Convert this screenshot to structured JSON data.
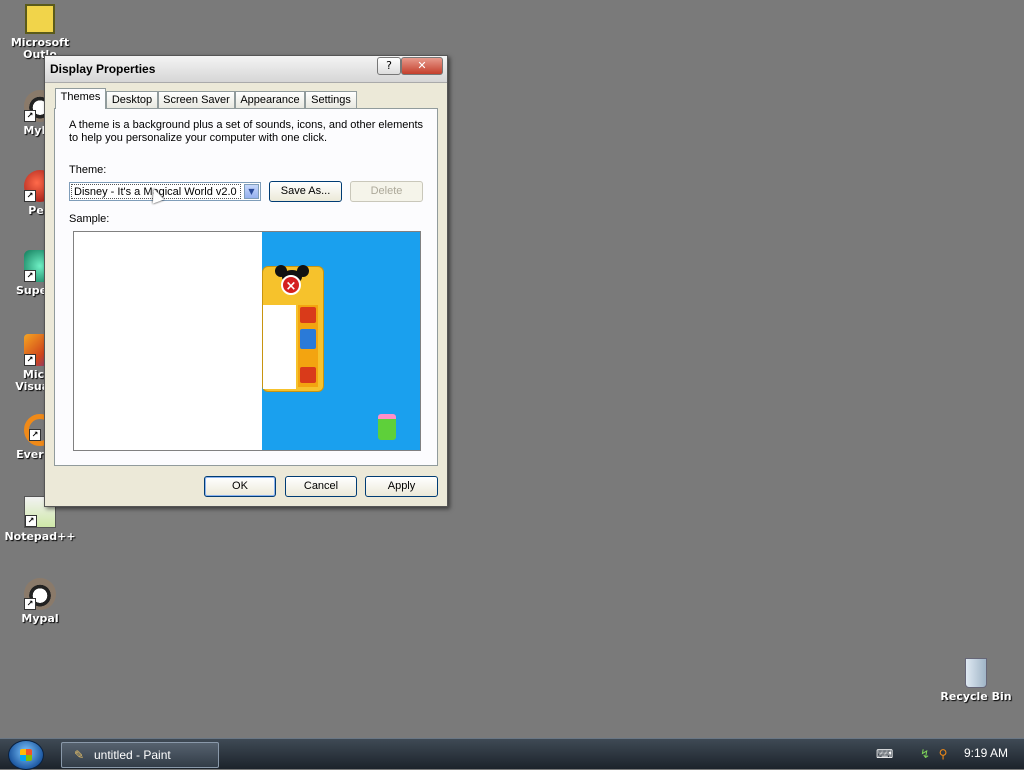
{
  "desktop": {
    "icons": [
      {
        "label": "Microsoft\nOutlo",
        "icon": "outlook-icon"
      },
      {
        "label": "MyPa",
        "icon": "raccoon-icon"
      },
      {
        "label": "Peg",
        "icon": "pegasus-icon"
      },
      {
        "label": "Superm",
        "icon": "supermemo-icon"
      },
      {
        "label": "Micro\nVisual S",
        "icon": "visual-studio-icon"
      },
      {
        "label": "Everyth",
        "icon": "everything-search-icon"
      },
      {
        "label": "Notepad++",
        "icon": "notepad-plus-plus-icon"
      },
      {
        "label": "Mypal",
        "icon": "raccoon-icon"
      },
      {
        "label": "Recycle Bin",
        "icon": "recycle-bin-icon"
      }
    ]
  },
  "dialog": {
    "title": "Display Properties",
    "help_glyph": "?",
    "close_glyph": "✕",
    "tabs": [
      {
        "label": "Themes",
        "active": true
      },
      {
        "label": "Desktop",
        "active": false
      },
      {
        "label": "Screen Saver",
        "active": false
      },
      {
        "label": "Appearance",
        "active": false
      },
      {
        "label": "Settings",
        "active": false
      }
    ],
    "description": "A theme is a background plus a set of sounds, icons, and other elements to help you personalize your computer with one click.",
    "theme_label": "Theme:",
    "theme_value": "Disney - It's a Magical World v2.0",
    "save_as_label": "Save As...",
    "delete_label": "Delete",
    "sample_label": "Sample:",
    "ok_label": "OK",
    "cancel_label": "Cancel",
    "apply_label": "Apply"
  },
  "taskbar": {
    "items": [
      {
        "label": "untitled - Paint",
        "icon": "paint-icon"
      }
    ],
    "clock": "9:19 AM",
    "tray_icons": [
      "keyboard-icon",
      "network-icon",
      "search-icon"
    ]
  },
  "colors": {
    "desktop": "#7a7a7a",
    "sample_background": "#1aa0ee",
    "taskbar": "#1c232b"
  }
}
